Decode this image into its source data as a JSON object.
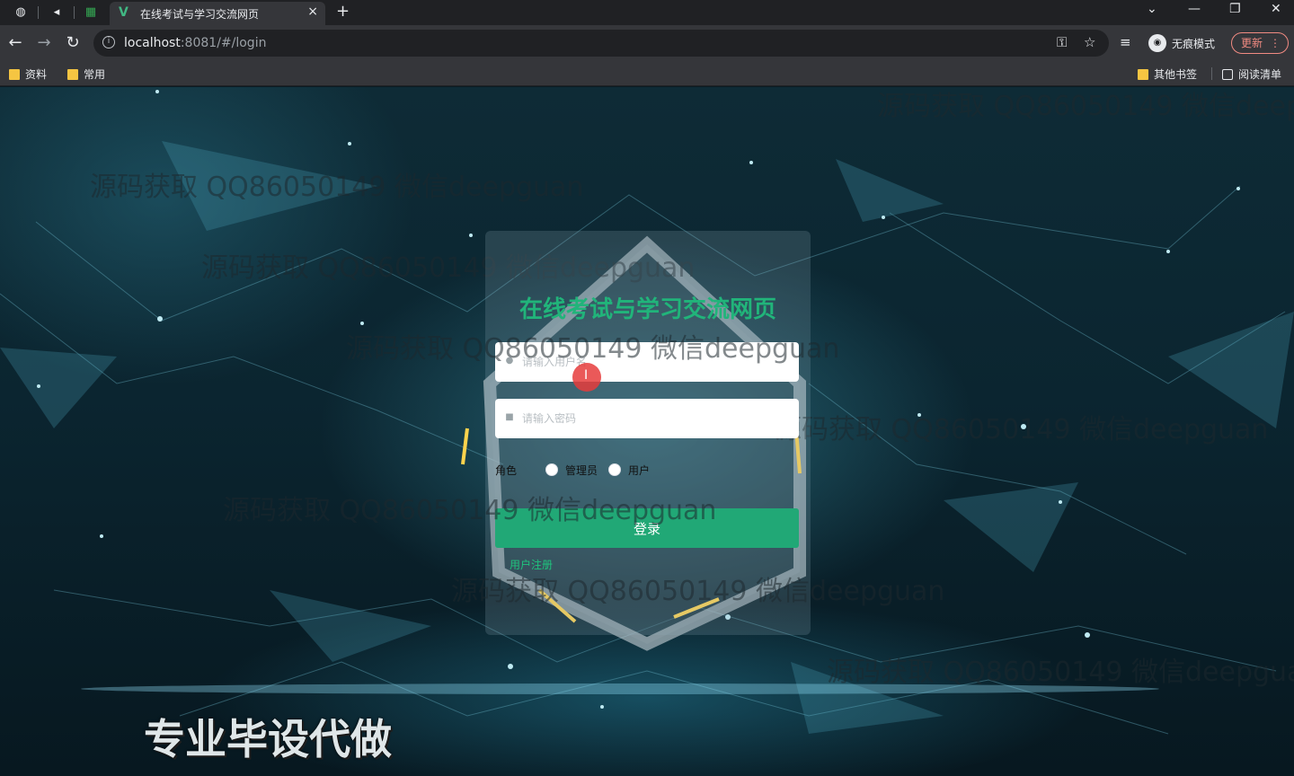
{
  "browser": {
    "tab_title": "在线考试与学习交流网页",
    "tab_close": "×",
    "new_tab": "+",
    "url_host": "localhost",
    "url_rest": ":8081/#/login",
    "incognito_label": "无痕模式",
    "update_label": "更新",
    "bookmarks": [
      "资料",
      "常用"
    ],
    "other_bookmarks": "其他书签",
    "reading_list": "阅读清单"
  },
  "login": {
    "title": "在线考试与学习交流网页",
    "username_placeholder": "请输入用户名",
    "password_placeholder": "请输入密码",
    "role_label": "角色",
    "roles": [
      "管理员",
      "用户"
    ],
    "login_button": "登录",
    "register_link": "用户注册"
  },
  "overlay": {
    "watermark": "源码获取 QQ86050149 微信deepguan",
    "banner": "专业毕设代做"
  },
  "icons": {
    "back": "arrow-left-icon",
    "forward": "arrow-right-icon",
    "reload": "reload-icon",
    "info": "info-icon",
    "key": "key-icon",
    "star": "star-icon",
    "user": "user-icon",
    "lock": "lock-icon"
  },
  "colors": {
    "accent_green": "#21a876",
    "title_green": "#21b47a",
    "update_red": "#f28b82"
  }
}
